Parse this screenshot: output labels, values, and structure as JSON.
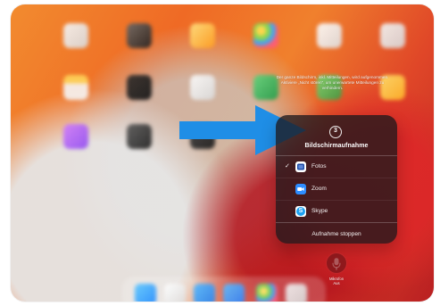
{
  "notice_text": "Der ganze Bildschirm, inkl. Mitteilungen, wird aufgenommen. Aktiviere „Nicht stören“, um unerwartete Mitteilungen zu verhindern.",
  "recording_panel": {
    "countdown": "3",
    "title": "Bildschirmaufnahme",
    "options": [
      {
        "label": "Fotos",
        "selected": true,
        "icon": "photos-icon"
      },
      {
        "label": "Zoom",
        "selected": false,
        "icon": "zoom-icon"
      },
      {
        "label": "Skype",
        "selected": false,
        "icon": "skype-icon"
      }
    ],
    "stop_label": "Aufnahme stoppen"
  },
  "microphone": {
    "label_line_1": "Mikrofon",
    "label_line_2": "Aus",
    "icon": "microphone-icon"
  },
  "decorations": {
    "arrow_icon": "arrow-right-icon",
    "checkmark_icon": "checkmark-icon"
  },
  "colors": {
    "arrow": "#1f8ee6",
    "panel": "#1e181c",
    "mic_button": "#78161a",
    "zoom": "#2d8cff",
    "skype": "#1da1f2"
  }
}
